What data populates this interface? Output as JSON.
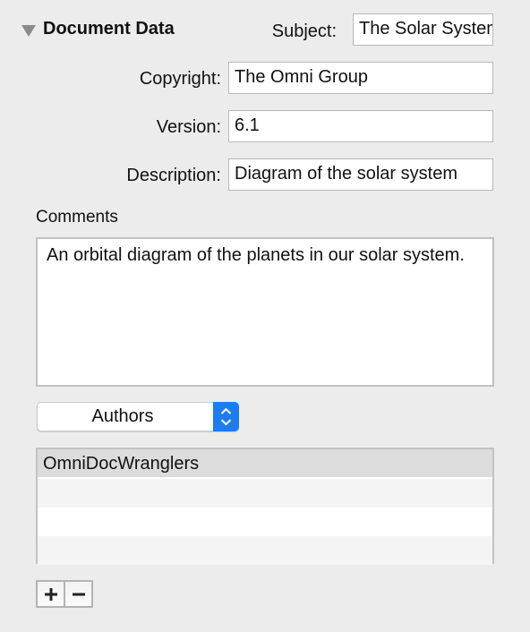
{
  "section": {
    "title": "Document Data",
    "expanded": true
  },
  "fields": {
    "subject": {
      "label": "Subject:",
      "value": "The Solar System"
    },
    "copyright": {
      "label": "Copyright:",
      "value": "The Omni Group"
    },
    "version": {
      "label": "Version:",
      "value": "6.1"
    },
    "description": {
      "label": "Description:",
      "value": "Diagram of the solar system"
    }
  },
  "comments": {
    "label": "Comments",
    "value": "An orbital diagram of the planets in our solar system."
  },
  "popup": {
    "selected": "Authors"
  },
  "list": {
    "rows": [
      "OmniDocWranglers",
      "",
      "",
      ""
    ]
  },
  "buttons": {
    "add": "+",
    "remove": "−"
  },
  "colors": {
    "accent": "#1d7cf2",
    "background": "#ececec"
  }
}
